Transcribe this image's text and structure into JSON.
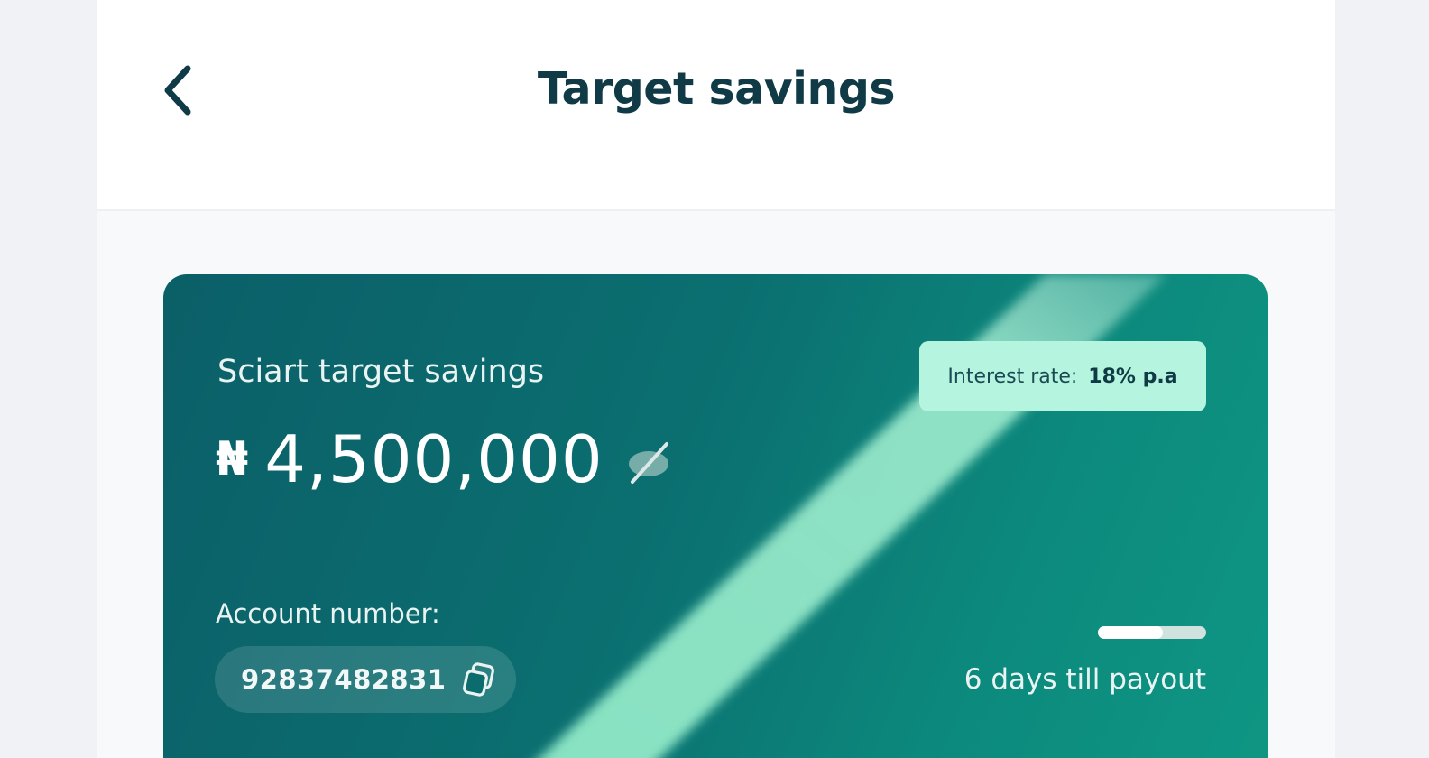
{
  "header": {
    "title": "Target savings",
    "back_icon": "chevron-left-icon"
  },
  "card": {
    "savings_name": "Sciart target savings",
    "currency_symbol": "₦",
    "balance": "4,500,000",
    "visibility_icon": "eye-off-icon",
    "interest_rate_label": "Interest rate:",
    "interest_rate_value": "18% p.a",
    "account_label": "Account number:",
    "account_number": "92837482831",
    "copy_icon": "copy-icon",
    "payout_progress": 0.6,
    "payout_text": "6 days till payout"
  },
  "colors": {
    "title": "#0f3a46",
    "card_start": "#0b5f68",
    "card_end": "#0f9683",
    "badge_bg": "#b5f4de",
    "shine": "#9ff0d0"
  }
}
